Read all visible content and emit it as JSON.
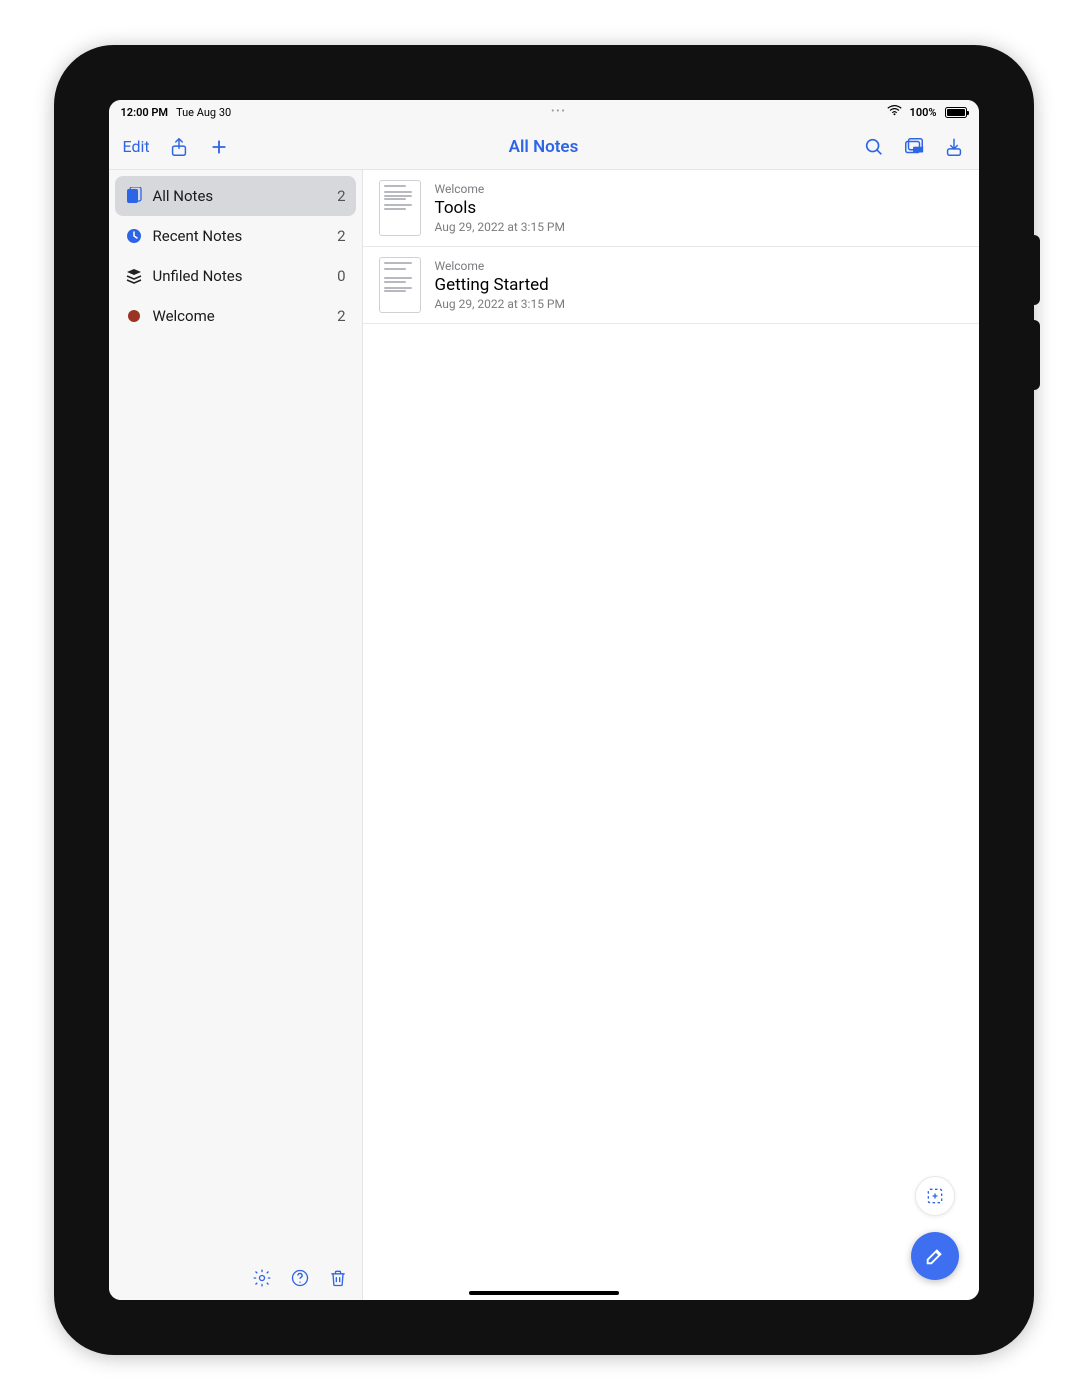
{
  "statusbar": {
    "time": "12:00 PM",
    "date": "Tue Aug 30",
    "pill": "•••",
    "battery_pct": "100%"
  },
  "toolbar": {
    "edit": "Edit",
    "title": "All Notes"
  },
  "sidebar": {
    "items": [
      {
        "label": "All Notes",
        "count": "2"
      },
      {
        "label": "Recent Notes",
        "count": "2"
      },
      {
        "label": "Unfiled Notes",
        "count": "0"
      },
      {
        "label": "Welcome",
        "count": "2"
      }
    ]
  },
  "notes": [
    {
      "category": "Welcome",
      "title": "Tools",
      "date": "Aug 29, 2022 at 3:15 PM"
    },
    {
      "category": "Welcome",
      "title": "Getting Started",
      "date": "Aug 29, 2022 at 3:15 PM"
    }
  ]
}
